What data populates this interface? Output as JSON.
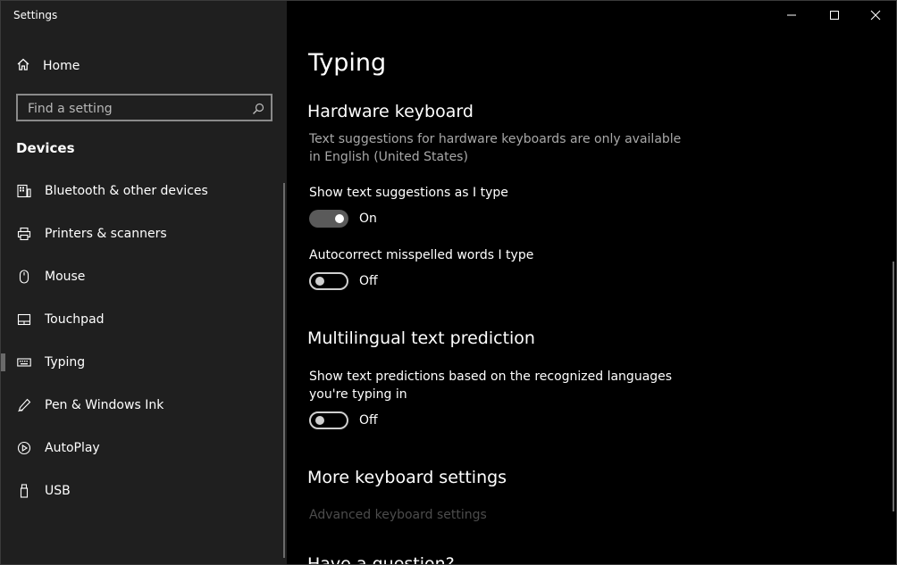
{
  "window": {
    "title": "Settings"
  },
  "sidebar": {
    "home_label": "Home",
    "search": {
      "placeholder": "Find a setting",
      "value": ""
    },
    "section_header": "Devices",
    "items": [
      {
        "label": "Bluetooth & other devices",
        "icon": "bluetooth-devices-icon"
      },
      {
        "label": "Printers & scanners",
        "icon": "printer-icon"
      },
      {
        "label": "Mouse",
        "icon": "mouse-icon"
      },
      {
        "label": "Touchpad",
        "icon": "touchpad-icon"
      },
      {
        "label": "Typing",
        "icon": "keyboard-icon",
        "selected": true
      },
      {
        "label": "Pen & Windows Ink",
        "icon": "pen-icon"
      },
      {
        "label": "AutoPlay",
        "icon": "autoplay-icon"
      },
      {
        "label": "USB",
        "icon": "usb-icon"
      }
    ]
  },
  "main": {
    "title": "Typing",
    "hardware": {
      "heading": "Hardware keyboard",
      "description": "Text suggestions for hardware keyboards are only available in English (United States)",
      "suggestions": {
        "label": "Show text suggestions as I type",
        "state": "On"
      },
      "autocorrect": {
        "label": "Autocorrect misspelled words I type",
        "state": "Off"
      }
    },
    "multilingual": {
      "heading": "Multilingual text prediction",
      "prediction": {
        "label": "Show text predictions based on the recognized languages you're typing in",
        "state": "Off"
      }
    },
    "more": {
      "heading": "More keyboard settings",
      "advanced_link": "Advanced keyboard settings"
    },
    "next_heading_partial": "Have a question?"
  },
  "colors": {
    "sidebar_bg": "#1f1f1f",
    "content_bg": "#000000",
    "toggle_on_bg": "#5a5a5a",
    "disabled_link": "#4c4c4c",
    "description_text": "#a8a8a8"
  }
}
